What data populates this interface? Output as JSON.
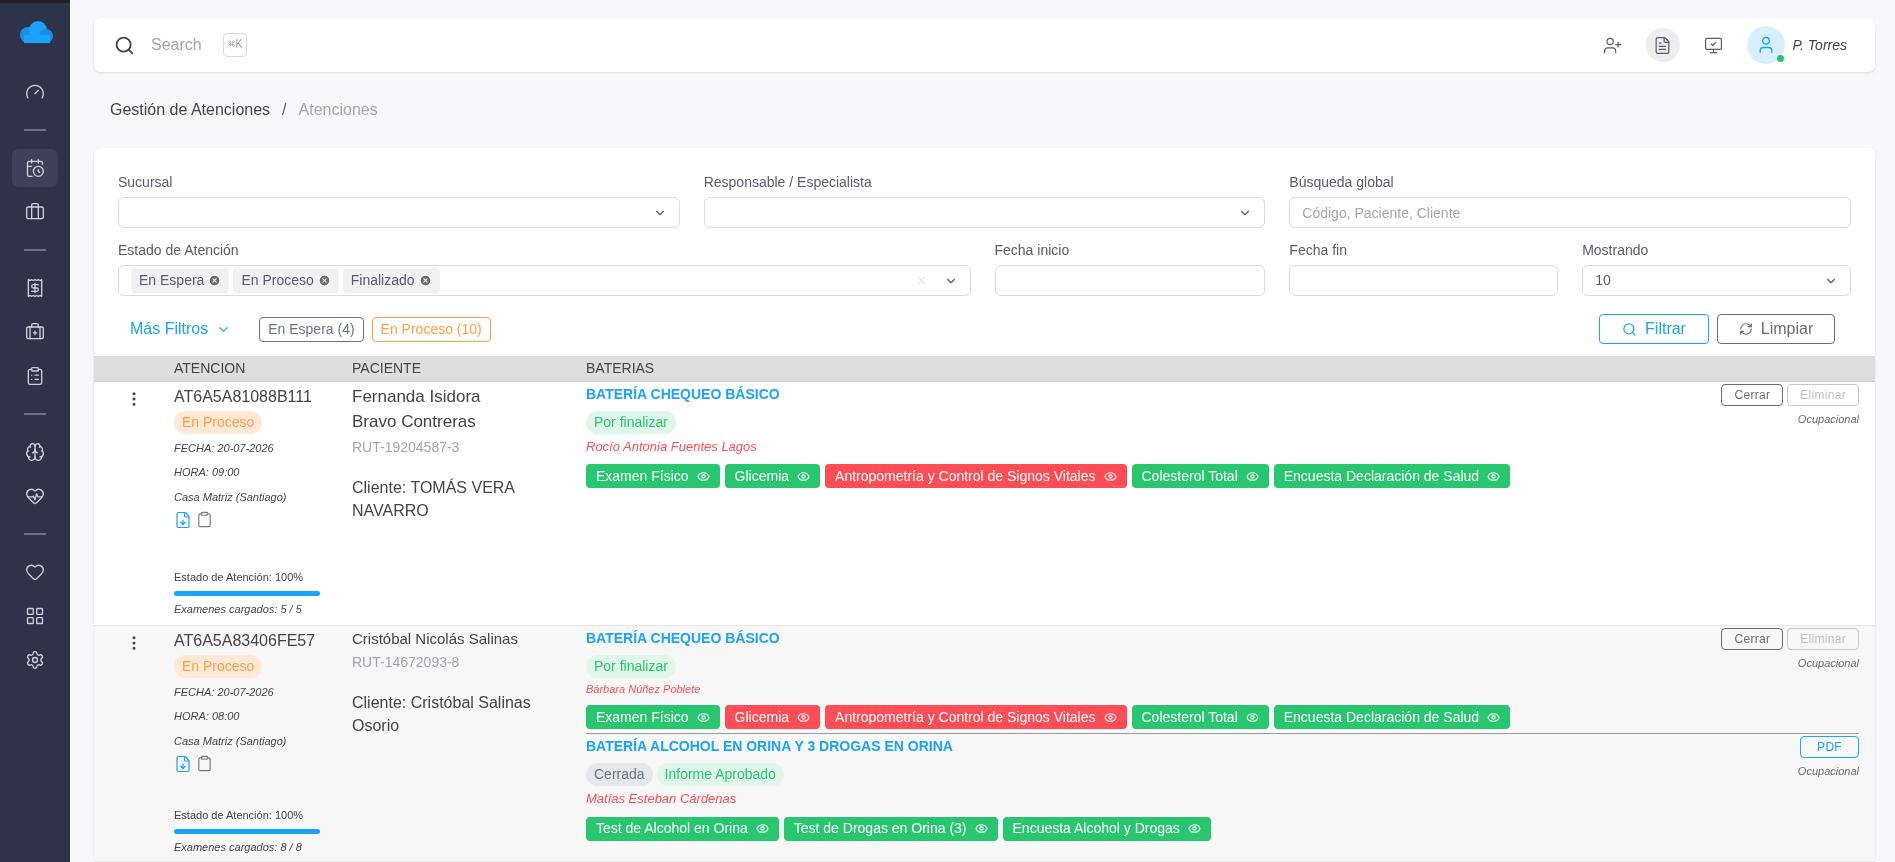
{
  "sidebar": {
    "groups": [
      [
        {
          "selected": false
        }
      ],
      [
        {
          "selected": true
        },
        {
          "selected": false
        }
      ],
      [
        {
          "selected": false
        },
        {
          "selected": false
        },
        {
          "selected": false
        }
      ],
      [
        {
          "selected": false
        },
        {
          "selected": false
        }
      ],
      [
        {
          "selected": false
        },
        {
          "selected": false
        },
        {
          "selected": false
        }
      ]
    ]
  },
  "topbar": {
    "search_placeholder": "Search",
    "shortcut": "⌘K",
    "user": {
      "name": "P. Torres",
      "online": true
    }
  },
  "breadcrumb": [
    {
      "label": "Gestión de Atenciones",
      "current": false
    },
    {
      "label": "Atenciones",
      "current": true
    }
  ],
  "breadcrumb_separator": "/",
  "filters": {
    "sucursal": {
      "label": "Sucursal"
    },
    "responsable": {
      "label": "Responsable / Especialista"
    },
    "busqueda": {
      "label": "Búsqueda global",
      "placeholder": "Código, Paciente, Cliente"
    },
    "estado": {
      "label": "Estado de Atención",
      "chips": [
        "En Espera",
        "En Proceso",
        "Finalizado"
      ]
    },
    "fecha_inicio": {
      "label": "Fecha inicio"
    },
    "fecha_fin": {
      "label": "Fecha fin"
    },
    "mostrando": {
      "label": "Mostrando",
      "value": "10"
    },
    "more_filters": "Más Filtros",
    "quick": [
      {
        "label": "En Espera (4)",
        "color": "#6b7280"
      },
      {
        "label": "En Proceso (10)",
        "color": "#ff9f43"
      }
    ],
    "buttons": [
      {
        "label": "Filtrar",
        "kind": "primary"
      },
      {
        "label": "Limpiar",
        "kind": "secondary"
      }
    ]
  },
  "table": {
    "columns": [
      "ATENCION",
      "PACIENTE",
      "BATERIAS"
    ],
    "rows": [
      {
        "code": "AT6A5A81088B111",
        "status": "En Proceso",
        "fecha": "FECHA: 20-07-2026",
        "hora": "HORA: 09:00",
        "sucursal": "Casa Matriz (Santiago)",
        "progress_label": "Estado de Atención: 100%",
        "level": 1,
        "exams": "Examenes cargados: 5 / 5",
        "patient": "Fernanda Isidora Bravo Contreras",
        "rut": "RUT-19204587-3",
        "client_label": "Cliente:",
        "client": "TOMÁS VERA NAVARRO",
        "batteries": [
          {
            "title": "BATERÍA CHEQUEO BÁSICO",
            "badges": [
              {
                "label": "Por finalizar",
                "kind": "success"
              }
            ],
            "responsible": "Rocío Antonia Fuentes Lagos",
            "tests": [
              {
                "label": "Examen Físico",
                "color": "#28c76f"
              },
              {
                "label": "Glicemia",
                "color": "#28c76f"
              },
              {
                "label": "Antropometría y Control de Signos Vitales",
                "color": "#ff4d55"
              },
              {
                "label": "Colesterol Total",
                "color": "#28c76f"
              },
              {
                "label": "Encuesta Declaración de Salud",
                "color": "#28c76f"
              }
            ],
            "actions": [
              {
                "label": "Cerrar",
                "kind": "outline",
                "disabled": false
              },
              {
                "label": "Eliminar",
                "kind": "outline",
                "disabled": true
              }
            ],
            "type": "Ocupacional"
          }
        ]
      },
      {
        "code": "AT6A5A83406FE57",
        "status": "En Proceso",
        "fecha": "FECHA: 20-07-2026",
        "hora": "HORA: 08:00",
        "sucursal": "Casa Matriz (Santiago)",
        "progress_label": "Estado de Atención: 100%",
        "level": 1,
        "exams": "Examenes cargados: 8 / 8",
        "patient": "Cristóbal Nicolás Salinas",
        "rut": "RUT-14672093-8",
        "client_label": "Cliente:",
        "client": "Cristóbal Salinas Osorio",
        "batteries": [
          {
            "title": "BATERÍA CHEQUEO BÁSICO",
            "badges": [
              {
                "label": "Por finalizar",
                "kind": "success"
              }
            ],
            "responsible": "Bárbara Núñez Poblete",
            "tests": [
              {
                "label": "Examen Físico",
                "color": "#28c76f"
              },
              {
                "label": "Glicemia",
                "color": "#ff4d55"
              },
              {
                "label": "Antropometría y Control de Signos Vitales",
                "color": "#ff4d55"
              },
              {
                "label": "Colesterol Total",
                "color": "#28c76f"
              },
              {
                "label": "Encuesta Declaración de Salud",
                "color": "#28c76f"
              }
            ],
            "actions": [
              {
                "label": "Cerrar",
                "kind": "outline",
                "disabled": false
              },
              {
                "label": "Eliminar",
                "kind": "outline",
                "disabled": true
              }
            ],
            "type": "Ocupacional"
          },
          {
            "title": "BATERÍA ALCOHOL EN ORINA Y 3 DROGAS EN ORINA",
            "badges": [
              {
                "label": "Cerrada",
                "kind": "neutral"
              },
              {
                "label": "Informe Aprobado",
                "kind": "success"
              }
            ],
            "responsible": "Matías Esteban Cárdenas",
            "tests": [
              {
                "label": "Test de Alcohol en Orina",
                "color": "#28c76f"
              },
              {
                "label": "Test de Drogas en Orina (3)",
                "color": "#28c76f"
              },
              {
                "label": "Encuesta Alcohol y Drogas",
                "color": "#28c76f"
              }
            ],
            "actions": [
              {
                "label": "PDF",
                "kind": "pdf"
              }
            ],
            "type": "Ocupacional"
          }
        ]
      }
    ]
  }
}
